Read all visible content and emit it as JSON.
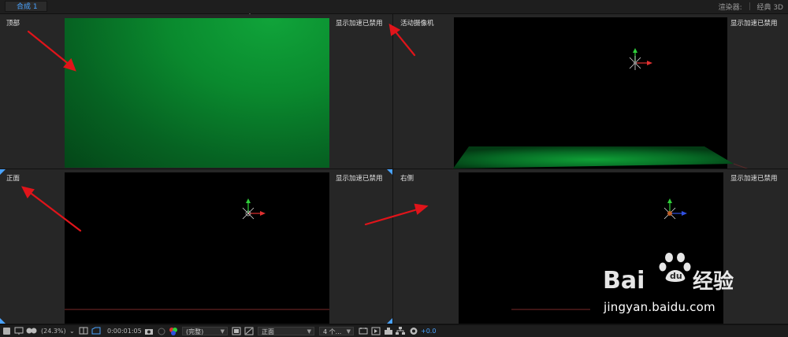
{
  "topbar": {
    "tab_label": "合成 1",
    "renderer_label": "渲染器:",
    "renderer_value": "经典 3D"
  },
  "viewports": {
    "top_left": {
      "label": "顶部",
      "accel": "显示加速已禁用"
    },
    "top_right": {
      "label": "活动摄像机",
      "accel": "显示加速已禁用"
    },
    "bottom_left": {
      "label": "正面",
      "accel": "显示加速已禁用"
    },
    "bottom_right": {
      "label": "右侧",
      "accel": "显示加速已禁用"
    }
  },
  "toolbar": {
    "zoom": "(24.3%)",
    "timecode": "0:00:01:05",
    "resolution": "(完整)",
    "view": "正面",
    "layout": "4 个...",
    "exposure": "+0.0"
  },
  "watermark": {
    "brand": "Bai du 经验",
    "url": "jingyan.baidu.com"
  },
  "colors": {
    "accent_blue": "#4aa3ff",
    "annotation_red": "#e0141a",
    "green_solid": "#0a7a2a"
  }
}
